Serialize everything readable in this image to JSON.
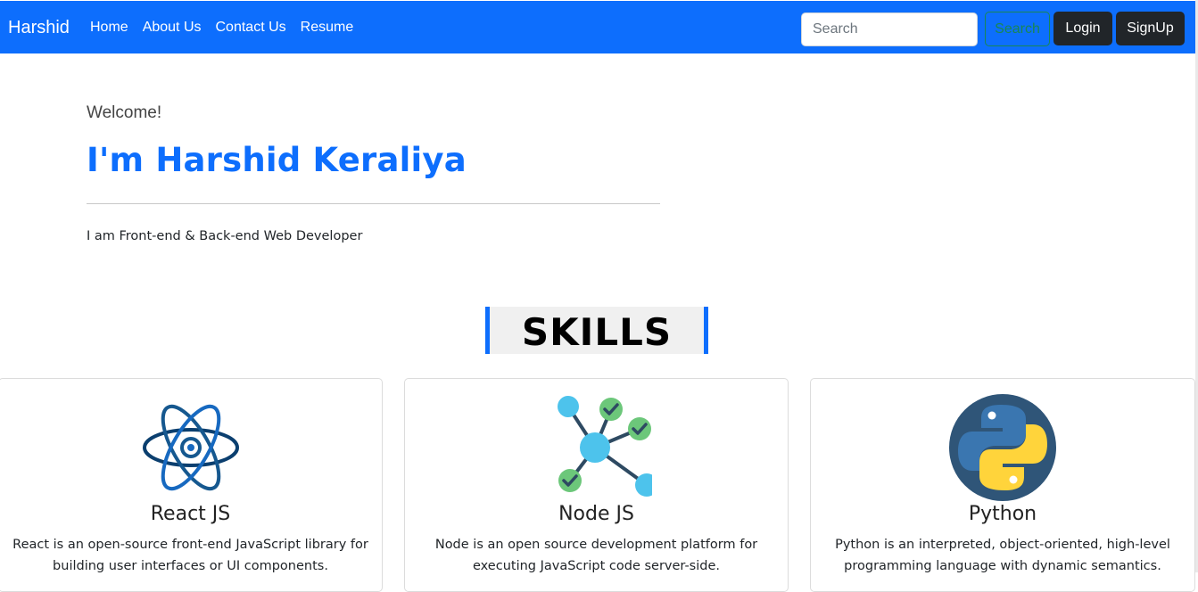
{
  "navbar": {
    "brand": "Harshid",
    "links": [
      "Home",
      "About Us",
      "Contact Us",
      "Resume"
    ],
    "search_placeholder": "Search",
    "search_button": "Search",
    "login_button": "Login",
    "signup_button": "SignUp",
    "bg_color": "#0d6efd"
  },
  "hero": {
    "welcome": "Welcome!",
    "title": "I'm Harshid Keraliya",
    "subtitle": "I am Front-end & Back-end Web Developer"
  },
  "skills": {
    "heading": "SKILLS",
    "cards": [
      {
        "icon": "react-atom-icon",
        "title": "React JS",
        "text": "React is an open-source front-end JavaScript library for building user interfaces or UI components."
      },
      {
        "icon": "node-network-icon",
        "title": "Node JS",
        "text": "Node is an open source development platform for executing JavaScript code server-side."
      },
      {
        "icon": "python-logo-icon",
        "title": "Python",
        "text": "Python is an interpreted, object-oriented, high-level programming language with dynamic semantics."
      }
    ]
  },
  "colors": {
    "accent": "#0d6efd",
    "dark_button": "#212529",
    "search_button": "#198754"
  }
}
